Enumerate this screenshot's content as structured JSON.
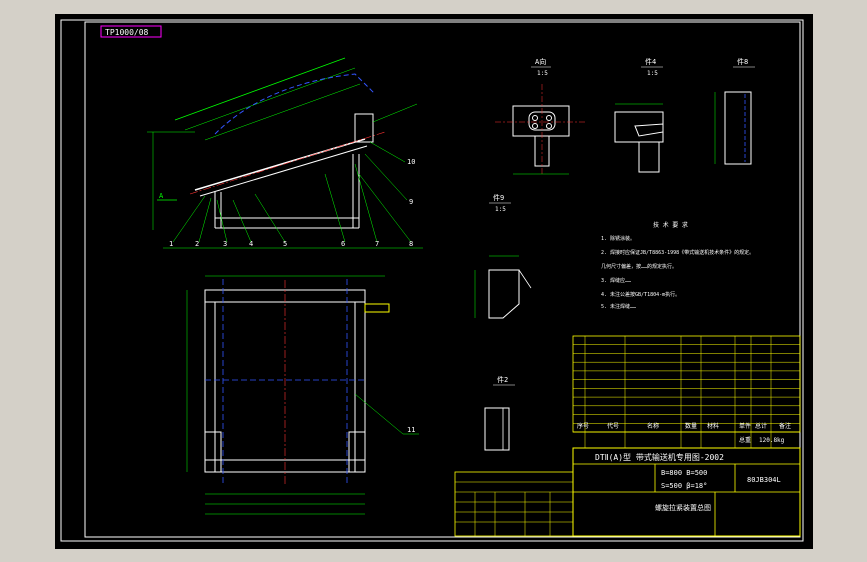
{
  "sheet": {
    "drawing_number_box": "TP1000/08",
    "title_block": {
      "machine_title": "DTⅡ(A)型  带式输送机专用图-2002",
      "param_line_1": "B=800 B=500",
      "param_line_2": "S=500 β=18°",
      "drawing_code": "80JB304L",
      "part_name": "螺旋拉紧装置总图"
    }
  },
  "views": {
    "view_a_label": "A向",
    "view_a_scale": "1:5",
    "part4_label": "件4",
    "part4_scale": "1:5",
    "part8_label": "件8",
    "part9_label": "件9",
    "part9_scale": "1:5",
    "part2_label": "件2",
    "view_a_arrow": "A"
  },
  "callouts": [
    "1",
    "2",
    "3",
    "4",
    "5",
    "6",
    "7",
    "8",
    "9",
    "10"
  ],
  "callout_11": "11",
  "notes": {
    "title": "技 术 要 求",
    "lines": [
      "1. 除锈涂装。",
      "2. 焊接时应保证JB/T8863-1998《带式输送机技术条件》的规定。",
      "   几何尺寸偏差，按……的规定执行。",
      "3. 焊缝应……",
      "4. 未注公差按GB/T1804-m执行。",
      "5. 未注焊缝……"
    ]
  },
  "bom": {
    "header": [
      "序号",
      "代号",
      "名称",
      "数量",
      "材料",
      "单件",
      "总计",
      "备注"
    ],
    "rows": 11
  },
  "footer_labels": {
    "weight_label": "总重",
    "weight_value": "120.8kg"
  }
}
